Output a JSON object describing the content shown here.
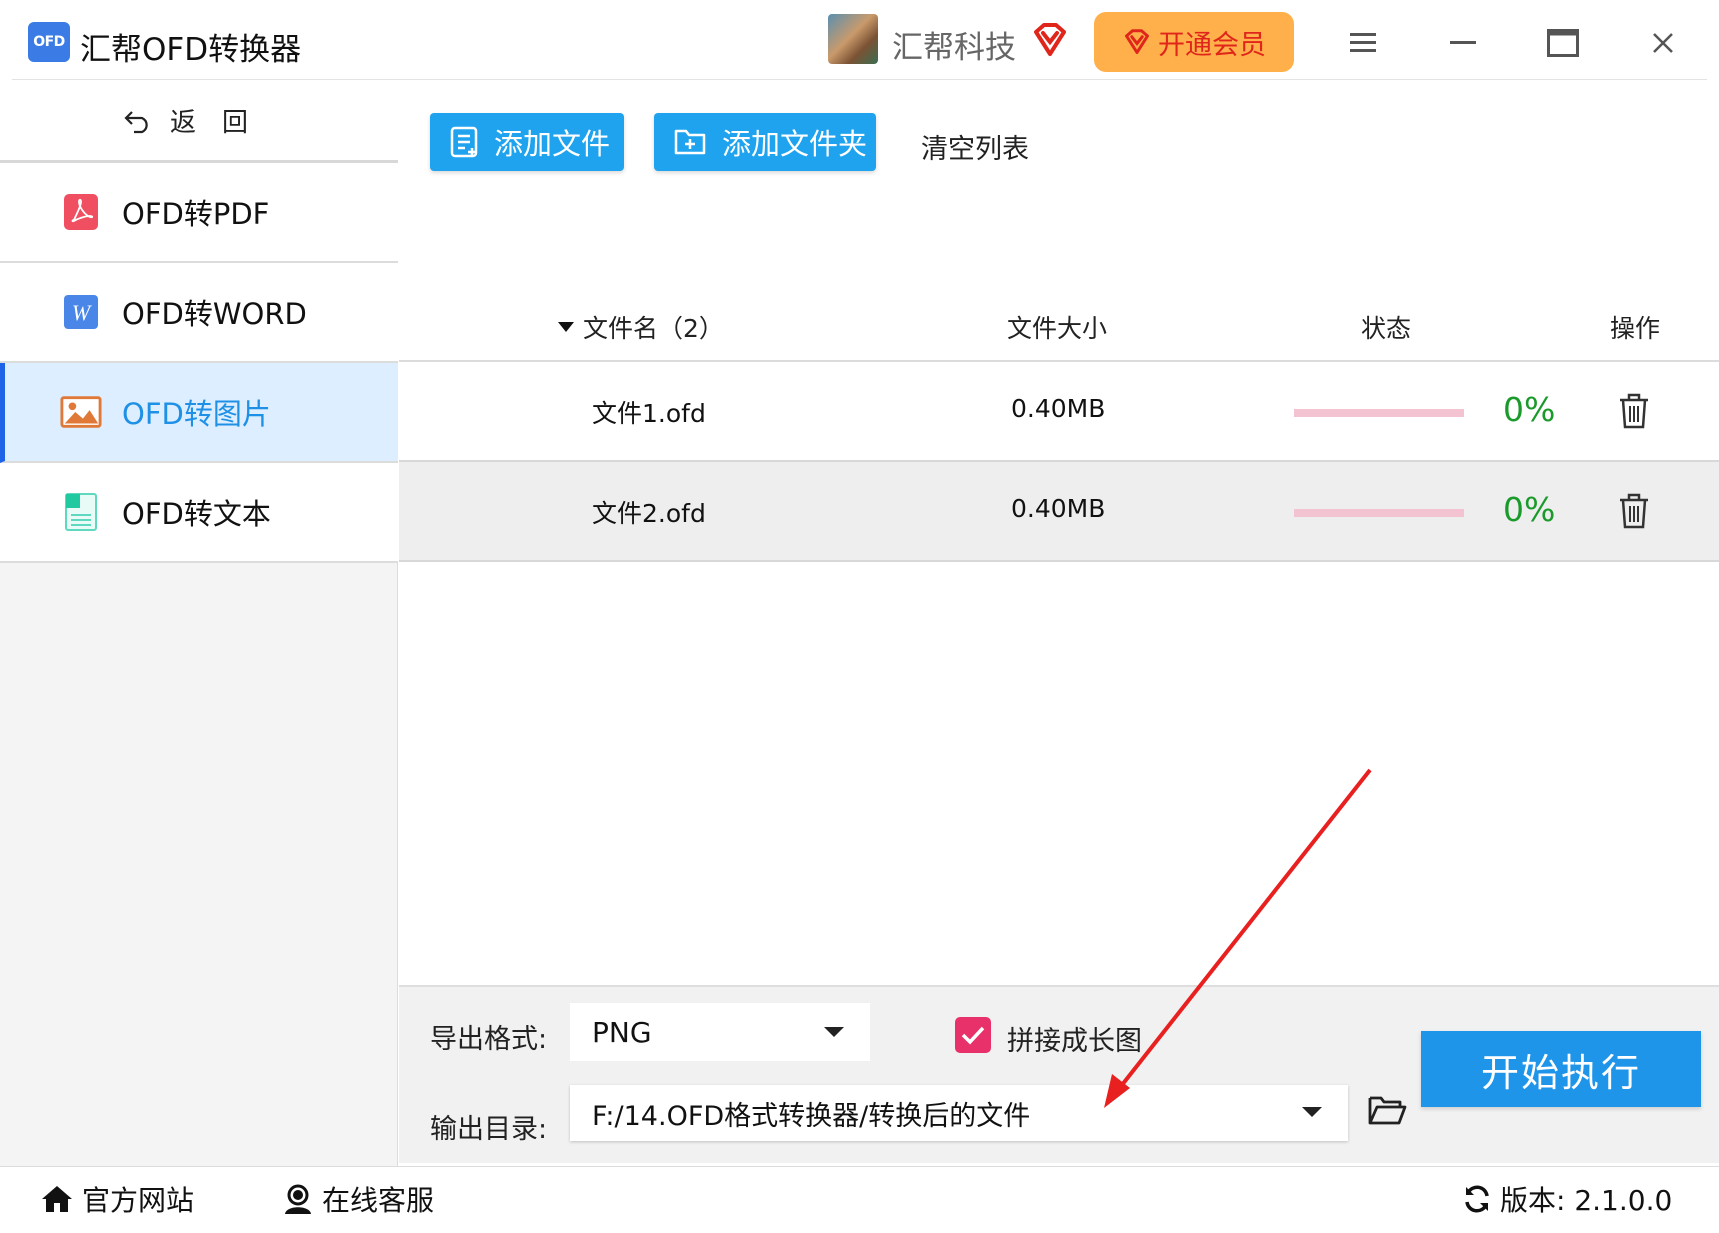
{
  "app": {
    "logo_text": "OFD",
    "title": "汇帮OFD转换器",
    "username": "汇帮科技",
    "vip_button": "开通会员"
  },
  "colors": {
    "accent_blue": "#1fa3ee",
    "vip_orange": "#ffb04a",
    "vip_red": "#e0251b",
    "active_nav_bg": "#dceeff",
    "progress_green": "#1a9a2a",
    "arrow_red": "#e82020"
  },
  "sidebar": {
    "back_label": "返回",
    "items": [
      {
        "label": "OFD转PDF",
        "icon": "pdf-icon",
        "active": false
      },
      {
        "label": "OFD转WORD",
        "icon": "word-icon",
        "active": false
      },
      {
        "label": "OFD转图片",
        "icon": "image-icon",
        "active": true
      },
      {
        "label": "OFD转文本",
        "icon": "text-doc-icon",
        "active": false
      }
    ]
  },
  "toolbar": {
    "add_file": "添加文件",
    "add_folder": "添加文件夹",
    "clear_list": "清空列表"
  },
  "table": {
    "headers": {
      "name": "文件名（2）",
      "size": "文件大小",
      "status": "状态",
      "action": "操作"
    },
    "rows": [
      {
        "name": "文件1.ofd",
        "size": "0.40MB",
        "progress": 0,
        "percent": "0%"
      },
      {
        "name": "文件2.ofd",
        "size": "0.40MB",
        "progress": 0,
        "percent": "0%"
      }
    ]
  },
  "settings": {
    "format_label": "导出格式:",
    "format_value": "PNG",
    "merge_checkbox_label": "拼接成长图",
    "merge_checked": true,
    "dir_label": "输出目录:",
    "dir_value": "F:/14.OFD格式转换器/转换后的文件",
    "start_button": "开始执行"
  },
  "footer": {
    "website": "官方网站",
    "service": "在线客服",
    "version": "版本: 2.1.0.0"
  }
}
